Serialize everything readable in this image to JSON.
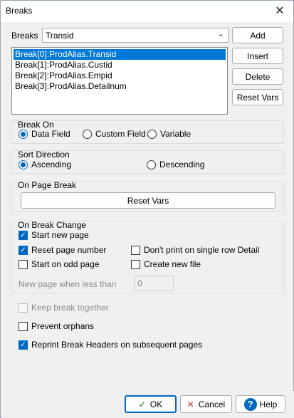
{
  "window": {
    "title": "Breaks"
  },
  "breaks": {
    "label": "Breaks",
    "selected": "Transid",
    "items": [
      "Break[0]:ProdAlias.Transid",
      "Break[1]:ProdAlias.Custid",
      "Break[2]:ProdAlias.Empid",
      "Break[3]:ProdAlias.Detailnum"
    ]
  },
  "side_buttons": {
    "add": "Add",
    "insert": "Insert",
    "delete": "Delete",
    "reset_vars": "Reset Vars"
  },
  "break_on": {
    "title": "Break On",
    "options": [
      "Data Field",
      "Custom Field",
      "Variable"
    ],
    "selected": "Data Field"
  },
  "sort_direction": {
    "title": "Sort Direction",
    "options": [
      "Ascending",
      "Descending"
    ],
    "selected": "Ascending"
  },
  "on_page_break": {
    "title": "On Page Break",
    "reset_vars": "Reset Vars"
  },
  "on_break_change": {
    "title": "On Break Change",
    "start_new_page": "Start new page",
    "reset_page_number": "Reset page number",
    "dont_print_single_row": "Don't print on single row Detail",
    "start_on_odd_page": "Start on odd page",
    "create_new_file": "Create new file",
    "new_page_when_less_than": "New page when less than",
    "new_page_value": "0"
  },
  "options": {
    "keep_break_together": "Keep break together",
    "prevent_orphans": "Prevent orphans",
    "reprint_headers": "Reprint Break Headers on subsequent pages"
  },
  "footer": {
    "ok": "OK",
    "cancel": "Cancel",
    "help": "Help"
  },
  "colors": {
    "accent": "#0067c0",
    "selection": "#0078d7",
    "cancel_icon": "#d13438",
    "ok_icon": "#107c10"
  }
}
